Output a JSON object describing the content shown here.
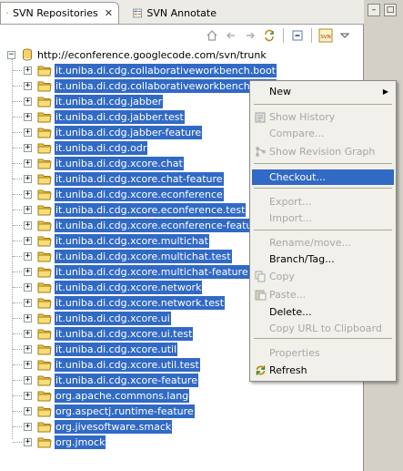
{
  "tabs": {
    "active": "SVN Repositories",
    "inactive": "SVN Annotate"
  },
  "repository": {
    "url": "http://econference.googlecode.com/svn/trunk",
    "items": [
      "it.uniba.di.cdg.collaborativeworkbench.boot",
      "it.uniba.di.cdg.collaborativeworkbench.boot",
      "it.uniba.di.cdg.jabber",
      "it.uniba.di.cdg.jabber.test",
      "it.uniba.di.cdg.jabber-feature",
      "it.uniba.di.cdg.odr",
      "it.uniba.di.cdg.xcore.chat",
      "it.uniba.di.cdg.xcore.chat-feature",
      "it.uniba.di.cdg.xcore.econference",
      "it.uniba.di.cdg.xcore.econference.test",
      "it.uniba.di.cdg.xcore.econference-feature",
      "it.uniba.di.cdg.xcore.multichat",
      "it.uniba.di.cdg.xcore.multichat.test",
      "it.uniba.di.cdg.xcore.multichat-feature",
      "it.uniba.di.cdg.xcore.network",
      "it.uniba.di.cdg.xcore.network.test",
      "it.uniba.di.cdg.xcore.ui",
      "it.uniba.di.cdg.xcore.ui.test",
      "it.uniba.di.cdg.xcore.util",
      "it.uniba.di.cdg.xcore.util.test",
      "it.uniba.di.cdg.xcore-feature",
      "org.apache.commons.lang",
      "org.aspectj.runtime-feature",
      "org.jivesoftware.smack",
      "org.jmock"
    ]
  },
  "context_menu": {
    "items": [
      {
        "label": "New",
        "enabled": true,
        "submenu": true
      },
      {
        "label": "Show History",
        "enabled": false,
        "icon": "history-icon"
      },
      {
        "label": "Compare...",
        "enabled": false
      },
      {
        "label": "Show Revision Graph",
        "enabled": false,
        "icon": "revision-graph-icon"
      },
      {
        "label": "Checkout...",
        "enabled": true,
        "highlighted": true
      },
      {
        "label": "Export...",
        "enabled": false
      },
      {
        "label": "Import...",
        "enabled": false
      },
      {
        "label": "Rename/move...",
        "enabled": false
      },
      {
        "label": "Branch/Tag...",
        "enabled": true
      },
      {
        "label": "Copy",
        "enabled": false,
        "icon": "copy-icon"
      },
      {
        "label": "Paste...",
        "enabled": false,
        "icon": "paste-icon"
      },
      {
        "label": "Delete...",
        "enabled": true
      },
      {
        "label": "Copy URL to Clipboard",
        "enabled": false
      },
      {
        "label": "Properties",
        "enabled": false
      },
      {
        "label": "Refresh",
        "enabled": true,
        "icon": "refresh-icon"
      }
    ]
  },
  "colors": {
    "selection": "#316ac5",
    "folder": "#f2c94c",
    "disabled_text": "#a7a6aa"
  }
}
